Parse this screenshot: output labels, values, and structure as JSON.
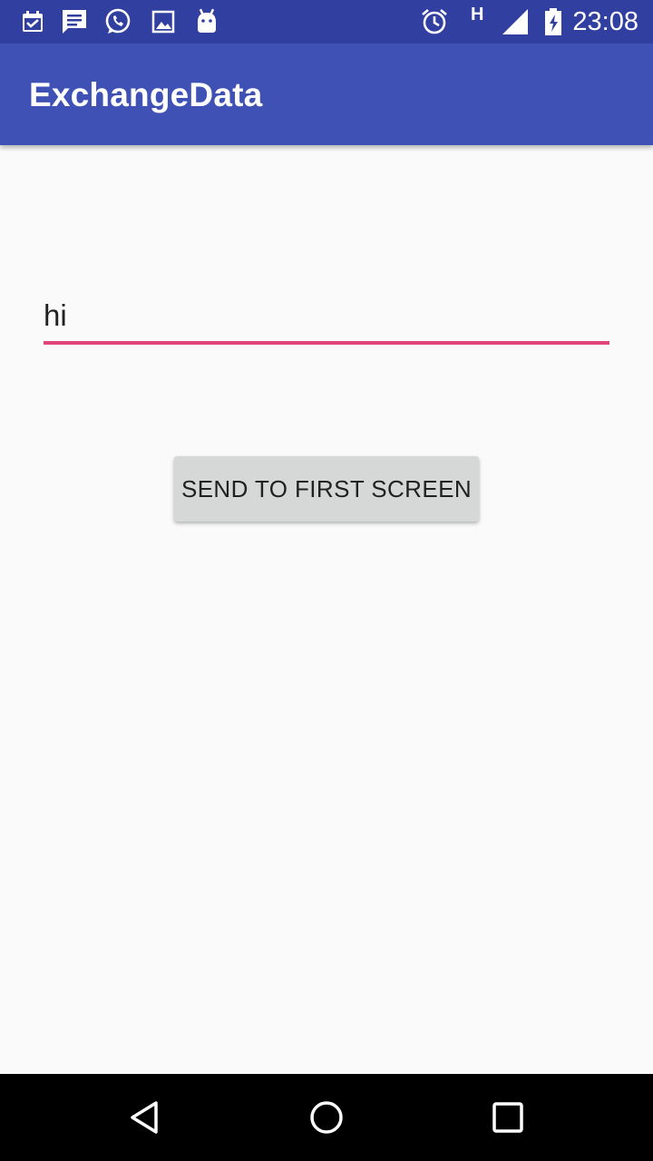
{
  "status_bar": {
    "time": "23:08",
    "network_type": "H",
    "icons": [
      "calendar-icon",
      "message-icon",
      "whatsapp-icon",
      "image-icon",
      "android-icon",
      "alarm-icon",
      "signal-icon",
      "battery-icon"
    ]
  },
  "app_bar": {
    "title": "ExchangeData"
  },
  "form": {
    "input_value": "hi",
    "send_button_label": "SEND TO FIRST SCREEN"
  },
  "nav_bar": {
    "buttons": [
      "back-icon",
      "home-icon",
      "recents-icon"
    ]
  },
  "colors": {
    "status_bar": "#3140a0",
    "app_bar": "#3f51b5",
    "accent": "#e0467a",
    "button_bg": "#d6d7d7",
    "background": "#fafafa"
  }
}
